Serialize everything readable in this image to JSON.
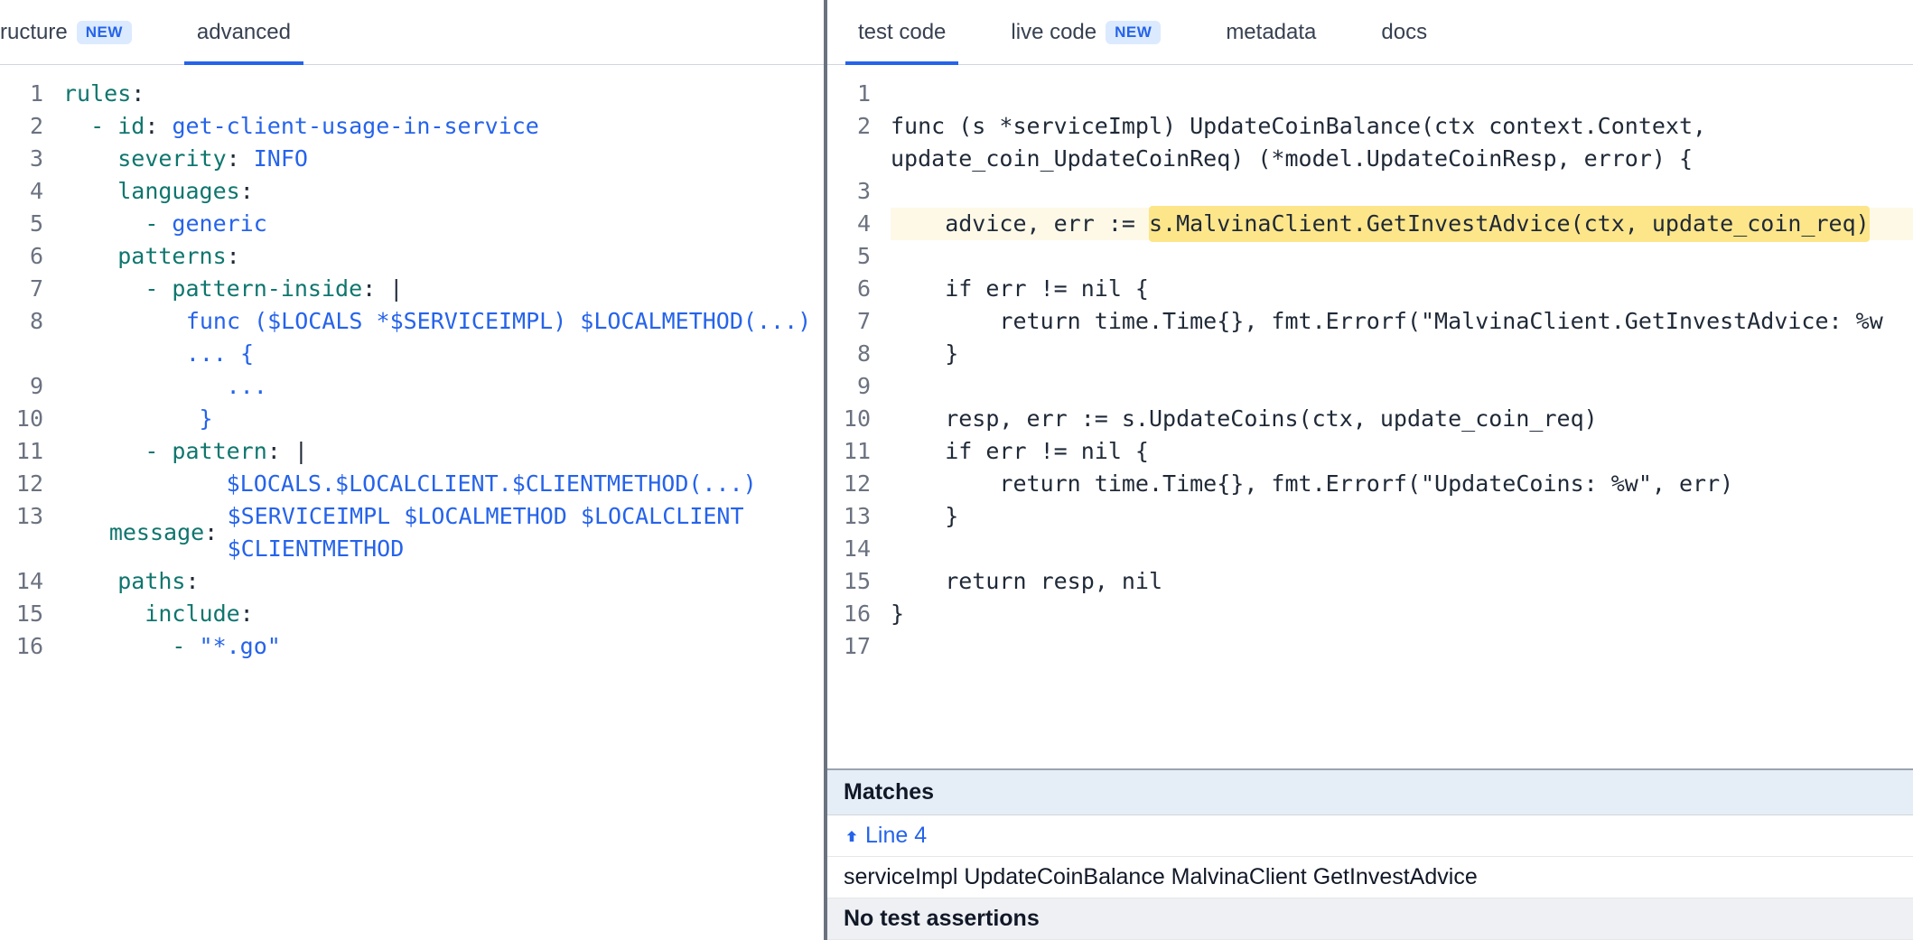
{
  "left": {
    "tabs": [
      {
        "label": "ructure",
        "badge": "NEW",
        "active": false,
        "truncated_left": true
      },
      {
        "label": "advanced",
        "badge": null,
        "active": true
      }
    ],
    "yaml_lines": [
      {
        "n": 1,
        "indent": "",
        "segs": [
          {
            "t": "key",
            "v": "rules"
          },
          {
            "t": "plain",
            "v": ":"
          }
        ]
      },
      {
        "n": 2,
        "indent": "  ",
        "segs": [
          {
            "t": "dash",
            "v": "- "
          },
          {
            "t": "key",
            "v": "id"
          },
          {
            "t": "plain",
            "v": ": "
          },
          {
            "t": "scalar",
            "v": "get-client-usage-in-service"
          }
        ]
      },
      {
        "n": 3,
        "indent": "    ",
        "segs": [
          {
            "t": "key",
            "v": "severity"
          },
          {
            "t": "plain",
            "v": ": "
          },
          {
            "t": "scalar",
            "v": "INFO"
          }
        ]
      },
      {
        "n": 4,
        "indent": "    ",
        "segs": [
          {
            "t": "key",
            "v": "languages"
          },
          {
            "t": "plain",
            "v": ":"
          }
        ]
      },
      {
        "n": 5,
        "indent": "      ",
        "segs": [
          {
            "t": "dash",
            "v": "- "
          },
          {
            "t": "scalar",
            "v": "generic"
          }
        ]
      },
      {
        "n": 6,
        "indent": "    ",
        "segs": [
          {
            "t": "key",
            "v": "patterns"
          },
          {
            "t": "plain",
            "v": ":"
          }
        ]
      },
      {
        "n": 7,
        "indent": "      ",
        "segs": [
          {
            "t": "dash",
            "v": "- "
          },
          {
            "t": "key",
            "v": "pattern-inside"
          },
          {
            "t": "plain",
            "v": ": "
          },
          {
            "t": "pipe",
            "v": "|"
          }
        ]
      },
      {
        "n": 8,
        "indent": "          ",
        "wrap": true,
        "segs": [
          {
            "t": "scalar",
            "v": "func ($LOCALS *$SERVICEIMPL) $LOCALMETHOD(...) ... {"
          }
        ]
      },
      {
        "n": 9,
        "indent": "            ",
        "segs": [
          {
            "t": "scalar",
            "v": "..."
          }
        ]
      },
      {
        "n": 10,
        "indent": "          ",
        "segs": [
          {
            "t": "scalar",
            "v": "}"
          }
        ]
      },
      {
        "n": 11,
        "indent": "      ",
        "segs": [
          {
            "t": "dash",
            "v": "- "
          },
          {
            "t": "key",
            "v": "pattern"
          },
          {
            "t": "plain",
            "v": ": "
          },
          {
            "t": "pipe",
            "v": "|"
          }
        ]
      },
      {
        "n": 12,
        "indent": "            ",
        "segs": [
          {
            "t": "scalar",
            "v": "$LOCALS.$LOCALCLIENT.$CLIENTMETHOD(...)"
          }
        ]
      },
      {
        "n": 13,
        "indent": "    ",
        "wrap": true,
        "segs": [
          {
            "t": "key",
            "v": "message"
          },
          {
            "t": "plain",
            "v": ": "
          },
          {
            "t": "scalar",
            "v": "$SERVICEIMPL $LOCALMETHOD $LOCALCLIENT $CLIENTMETHOD"
          }
        ]
      },
      {
        "n": 14,
        "indent": "    ",
        "segs": [
          {
            "t": "key",
            "v": "paths"
          },
          {
            "t": "plain",
            "v": ":"
          }
        ]
      },
      {
        "n": 15,
        "indent": "      ",
        "segs": [
          {
            "t": "key",
            "v": "include"
          },
          {
            "t": "plain",
            "v": ":"
          }
        ]
      },
      {
        "n": 16,
        "indent": "        ",
        "segs": [
          {
            "t": "dash",
            "v": "- "
          },
          {
            "t": "scalar",
            "v": "\"*.go\""
          }
        ]
      }
    ]
  },
  "right": {
    "tabs": [
      {
        "label": "test code",
        "badge": null,
        "active": true
      },
      {
        "label": "live code",
        "badge": "NEW",
        "active": false
      },
      {
        "label": "metadata",
        "badge": null,
        "active": false
      },
      {
        "label": "docs",
        "badge": null,
        "active": false
      }
    ],
    "go_lines": [
      {
        "n": 1,
        "segs": []
      },
      {
        "n": 2,
        "wrap": true,
        "segs": [
          {
            "t": "plain",
            "v": "func (s *serviceImpl) UpdateCoinBalance(ctx context.Context, update_coin_UpdateCoinReq) (*model.UpdateCoinResp, error) {"
          }
        ]
      },
      {
        "n": 3,
        "segs": []
      },
      {
        "n": 4,
        "highlight_after": "    advice, err := ",
        "highlight": "s.MalvinaClient.GetInvestAdvice(ctx, update_coin_req)",
        "segs": []
      },
      {
        "n": 5,
        "segs": []
      },
      {
        "n": 6,
        "segs": [
          {
            "t": "plain",
            "v": "    if err != nil {"
          }
        ]
      },
      {
        "n": 7,
        "segs": [
          {
            "t": "plain",
            "v": "        return time.Time{}, fmt.Errorf(\"MalvinaClient.GetInvestAdvice: %w"
          }
        ]
      },
      {
        "n": 8,
        "segs": [
          {
            "t": "plain",
            "v": "    }"
          }
        ]
      },
      {
        "n": 9,
        "segs": []
      },
      {
        "n": 10,
        "segs": [
          {
            "t": "plain",
            "v": "    resp, err := s.UpdateCoins(ctx, update_coin_req)"
          }
        ]
      },
      {
        "n": 11,
        "segs": [
          {
            "t": "plain",
            "v": "    if err != nil {"
          }
        ]
      },
      {
        "n": 12,
        "segs": [
          {
            "t": "plain",
            "v": "        return time.Time{}, fmt.Errorf(\"UpdateCoins: %w\", err)"
          }
        ]
      },
      {
        "n": 13,
        "segs": [
          {
            "t": "plain",
            "v": "    }"
          }
        ]
      },
      {
        "n": 14,
        "segs": []
      },
      {
        "n": 15,
        "segs": [
          {
            "t": "plain",
            "v": "    return resp, nil"
          }
        ]
      },
      {
        "n": 16,
        "segs": [
          {
            "t": "plain",
            "v": "}"
          }
        ]
      },
      {
        "n": 17,
        "segs": []
      }
    ],
    "matches": {
      "header": "Matches",
      "line_link": "Line 4",
      "message": "serviceImpl UpdateCoinBalance MalvinaClient GetInvestAdvice",
      "no_assertions": "No test assertions"
    }
  }
}
